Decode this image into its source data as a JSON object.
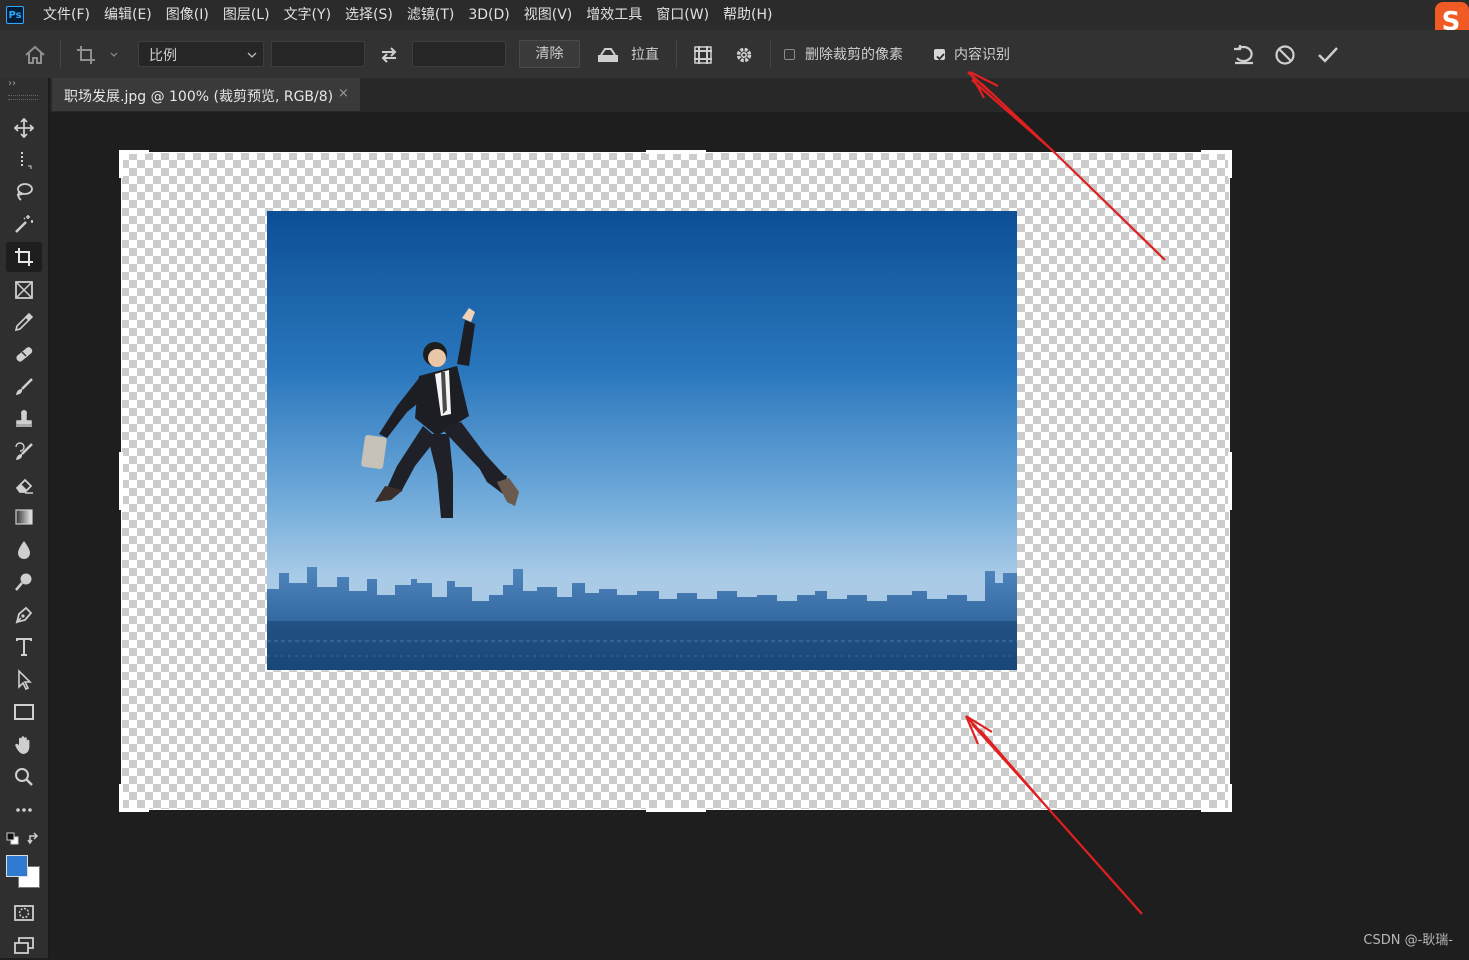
{
  "app": {
    "logo_text": "Ps"
  },
  "menu": {
    "items": [
      "文件(F)",
      "编辑(E)",
      "图像(I)",
      "图层(L)",
      "文字(Y)",
      "选择(S)",
      "滤镜(T)",
      "3D(D)",
      "视图(V)",
      "增效工具",
      "窗口(W)",
      "帮助(H)"
    ]
  },
  "options_bar": {
    "ratio_select": "比例",
    "width_value": "",
    "height_value": "",
    "clear_button": "清除",
    "straighten_label": "拉直",
    "delete_cropped_pixels": {
      "label": "删除裁剪的像素",
      "checked": false
    },
    "content_aware": {
      "label": "内容识别",
      "checked": true
    }
  },
  "document": {
    "tab_title": "职场发展.jpg @ 100% (裁剪预览, RGB/8)",
    "close_glyph": "×"
  },
  "toolbar": {
    "collapse_glyph": "››",
    "tools": [
      "move-tool",
      "marquee-tool",
      "lasso-tool",
      "magic-wand-tool",
      "crop-tool",
      "frame-tool",
      "eyedropper-tool",
      "healing-brush-tool",
      "brush-tool",
      "clone-stamp-tool",
      "history-brush-tool",
      "eraser-tool",
      "gradient-tool",
      "blur-tool",
      "dodge-tool",
      "pen-tool",
      "type-tool",
      "path-selection-tool",
      "rectangle-tool",
      "hand-tool",
      "zoom-tool",
      "more-tools"
    ],
    "active_tool": "crop-tool",
    "foreground_color": "#2e7bd0",
    "background_color": "#ffffff"
  },
  "colors": {
    "annotation_arrow": "#e02020",
    "canvas_background": "#1e1e1e"
  },
  "watermark": "CSDN @-耿瑞-"
}
